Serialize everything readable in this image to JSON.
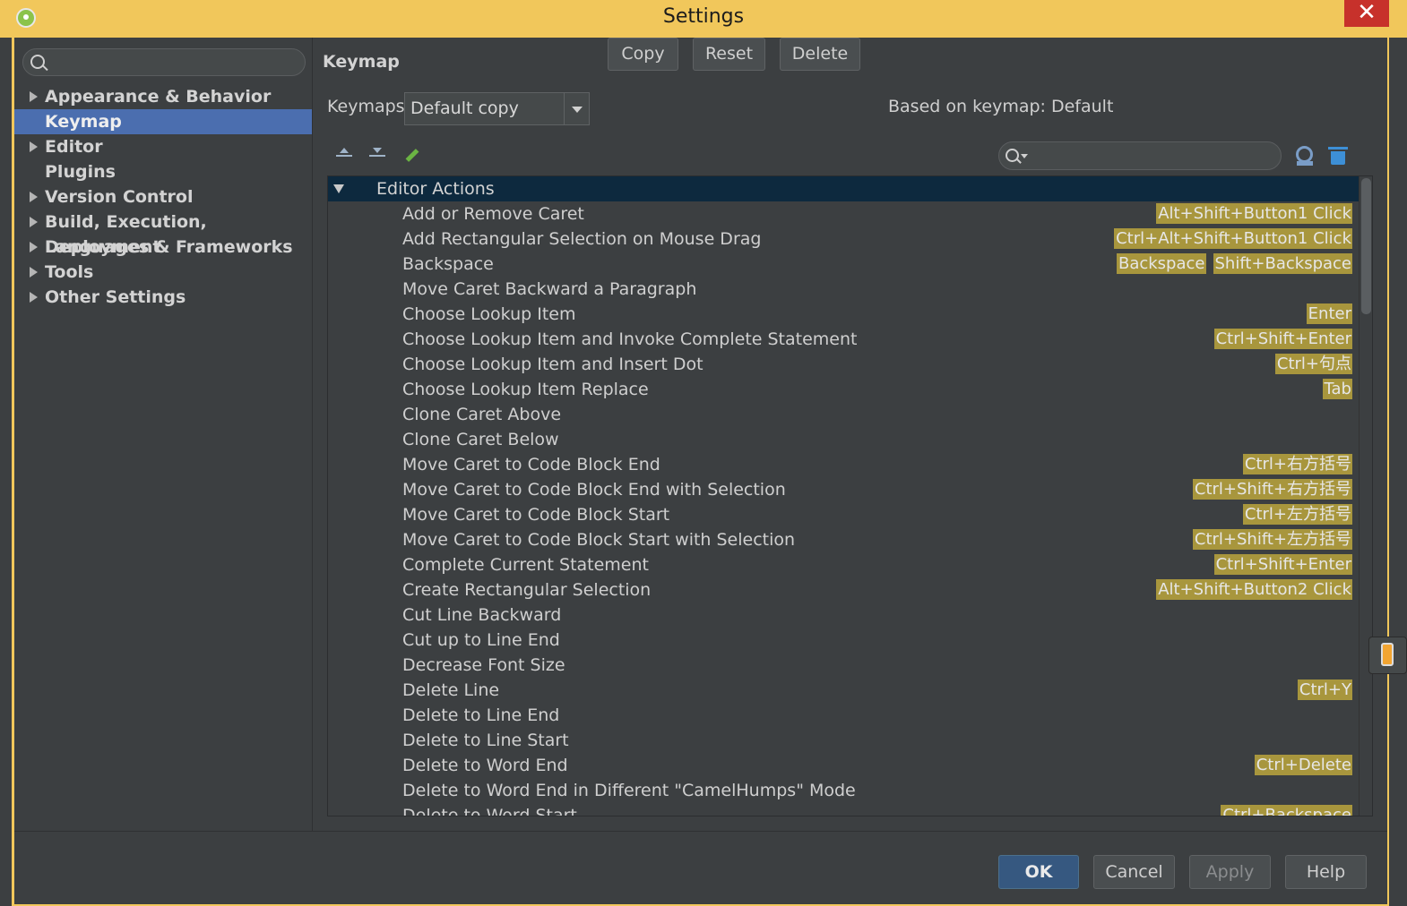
{
  "window": {
    "title": "Settings",
    "close_glyph": "✕"
  },
  "sidebar": {
    "search_placeholder": "",
    "items": [
      {
        "label": "Appearance & Behavior",
        "expandable": true
      },
      {
        "label": "Keymap",
        "selected": true
      },
      {
        "label": "Editor",
        "expandable": true
      },
      {
        "label": "Plugins"
      },
      {
        "label": "Version Control",
        "expandable": true
      },
      {
        "label": "Build, Execution, Deployment",
        "expandable": true
      },
      {
        "label": "Languages & Frameworks",
        "expandable": true
      },
      {
        "label": "Tools",
        "expandable": true
      },
      {
        "label": "Other Settings",
        "expandable": true
      }
    ]
  },
  "keymap": {
    "heading": "Keymap",
    "keymaps_label": "Keymaps:",
    "keymaps_selected": "Default copy",
    "copy_label": "Copy",
    "reset_label": "Reset",
    "delete_label": "Delete",
    "based_on": "Based on keymap: Default",
    "filter_placeholder": "",
    "group": "Editor Actions",
    "actions": [
      {
        "name": "Add or Remove Caret",
        "keys": [
          "Alt+Shift+Button1 Click"
        ]
      },
      {
        "name": "Add Rectangular Selection on Mouse Drag",
        "keys": [
          "Ctrl+Alt+Shift+Button1 Click"
        ]
      },
      {
        "name": "Backspace",
        "keys": [
          "Backspace",
          "Shift+Backspace"
        ]
      },
      {
        "name": "Move Caret Backward a Paragraph",
        "keys": []
      },
      {
        "name": "Choose Lookup Item",
        "keys": [
          "Enter"
        ]
      },
      {
        "name": "Choose Lookup Item and Invoke Complete Statement",
        "keys": [
          "Ctrl+Shift+Enter"
        ]
      },
      {
        "name": "Choose Lookup Item and Insert Dot",
        "keys": [
          "Ctrl+句点"
        ]
      },
      {
        "name": "Choose Lookup Item Replace",
        "keys": [
          "Tab"
        ]
      },
      {
        "name": "Clone Caret Above",
        "keys": []
      },
      {
        "name": "Clone Caret Below",
        "keys": []
      },
      {
        "name": "Move Caret to Code Block End",
        "keys": [
          "Ctrl+右方括号"
        ]
      },
      {
        "name": "Move Caret to Code Block End with Selection",
        "keys": [
          "Ctrl+Shift+右方括号"
        ]
      },
      {
        "name": "Move Caret to Code Block Start",
        "keys": [
          "Ctrl+左方括号"
        ]
      },
      {
        "name": "Move Caret to Code Block Start with Selection",
        "keys": [
          "Ctrl+Shift+左方括号"
        ]
      },
      {
        "name": "Complete Current Statement",
        "keys": [
          "Ctrl+Shift+Enter"
        ]
      },
      {
        "name": "Create Rectangular Selection",
        "keys": [
          "Alt+Shift+Button2 Click"
        ]
      },
      {
        "name": "Cut Line Backward",
        "keys": []
      },
      {
        "name": "Cut up to Line End",
        "keys": []
      },
      {
        "name": "Decrease Font Size",
        "keys": []
      },
      {
        "name": "Delete Line",
        "keys": [
          "Ctrl+Y"
        ]
      },
      {
        "name": "Delete to Line End",
        "keys": []
      },
      {
        "name": "Delete to Line Start",
        "keys": []
      },
      {
        "name": "Delete to Word End",
        "keys": [
          "Ctrl+Delete"
        ]
      },
      {
        "name": "Delete to Word End in Different \"CamelHumps\" Mode",
        "keys": []
      },
      {
        "name": "Delete to Word Start",
        "keys": [
          "Ctrl+Backspace"
        ]
      }
    ]
  },
  "footer": {
    "ok": "OK",
    "cancel": "Cancel",
    "apply": "Apply",
    "help": "Help"
  },
  "colors": {
    "accent": "#4b6eaf",
    "shortcut_bg": "#a8963d",
    "title_bar": "#f1c75b",
    "group_row": "#0d293e"
  }
}
